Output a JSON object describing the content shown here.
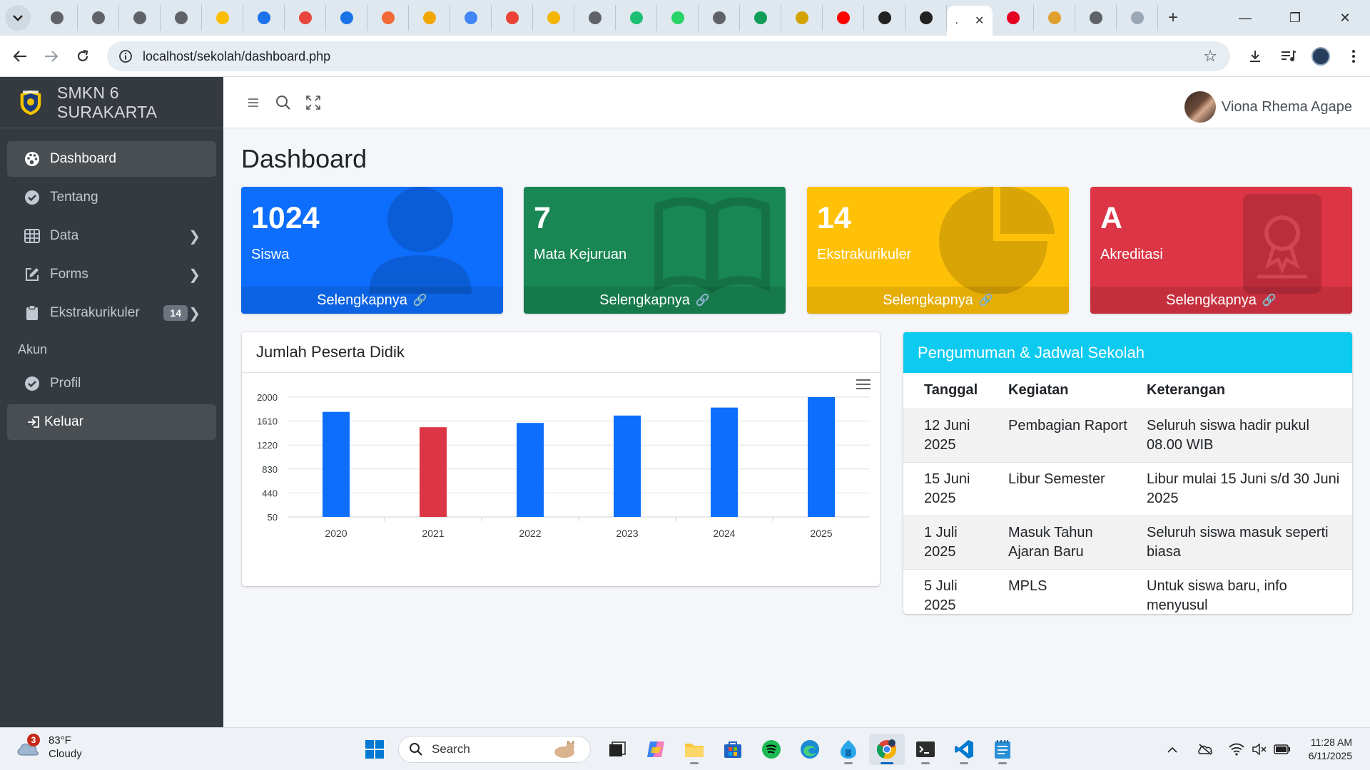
{
  "browser": {
    "url": "localhost/sekolah/dashboard.php",
    "tab_favicon_colors": [
      "#5f6368",
      "#5f6368",
      "#5f6368",
      "#5f6368",
      "#fbbc04",
      "#1a73e8",
      "#e8453c",
      "#1a73e8",
      "#f06a35",
      "#f2a600",
      "#4285f4",
      "#ea4335",
      "#f4b400",
      "#5f6368",
      "#1dbf73",
      "#25d366",
      "#5f6368",
      "#0f9d58",
      "#d4a200",
      "#ff0000",
      "#222222",
      "#222222"
    ],
    "active_tab_title": ".",
    "after_tabs_colors": [
      "#e60023",
      "#e0a030",
      "#5f6368",
      "#9aa7b5"
    ]
  },
  "sidebar": {
    "brand": "SMKN 6 SURAKARTA",
    "items": [
      {
        "label": "Dashboard",
        "icon": "palette-icon",
        "active": true
      },
      {
        "label": "Tentang",
        "icon": "circle-check-icon"
      },
      {
        "label": "Data",
        "icon": "table-icon",
        "chevron": true
      },
      {
        "label": "Forms",
        "icon": "edit-icon",
        "chevron": true
      },
      {
        "label": "Ekstrakurikuler",
        "icon": "clipboard-icon",
        "badge": "14",
        "chevron": true
      }
    ],
    "header_akun": "Akun",
    "profil": "Profil",
    "logout": "Keluar"
  },
  "topnav": {
    "user_name": "Viona Rhema Agape"
  },
  "page": {
    "title": "Dashboard"
  },
  "stats": [
    {
      "number": "1024",
      "label": "Siswa",
      "link": "Selengkapnya",
      "color": "#0d6efd",
      "icon": "person-icon"
    },
    {
      "number": "7",
      "label": "Mata Kejuruan",
      "link": "Selengkapnya",
      "color": "#198754",
      "icon": "book-icon"
    },
    {
      "number": "14",
      "label": "Ekstrakurikuler",
      "link": "Selengkapnya",
      "color": "#ffc107",
      "icon": "pie-chart-icon"
    },
    {
      "number": "A",
      "label": "Akreditasi",
      "link": "Selengkapnya",
      "color": "#dc3545",
      "icon": "certificate-icon"
    }
  ],
  "chart_card": {
    "title": "Jumlah Peserta Didik"
  },
  "chart_data": {
    "type": "bar",
    "title": "",
    "xlabel": "",
    "ylabel": "",
    "categories": [
      "2020",
      "2021",
      "2022",
      "2023",
      "2024",
      "2025"
    ],
    "values": [
      1760,
      1510,
      1580,
      1700,
      1830,
      2000
    ],
    "bar_colors": [
      "#0d6efd",
      "#dc3545",
      "#0d6efd",
      "#0d6efd",
      "#0d6efd",
      "#0d6efd"
    ],
    "yticks": [
      50,
      440,
      830,
      1220,
      1610,
      2000
    ],
    "ylim": [
      50,
      2000
    ],
    "grid": true
  },
  "schedule": {
    "title": "Pengumuman & Jadwal Sekolah",
    "headers": [
      "Tanggal",
      "Kegiatan",
      "Keterangan"
    ],
    "rows": [
      [
        "12 Juni 2025",
        "Pembagian Raport",
        "Seluruh siswa hadir pukul 08.00 WIB"
      ],
      [
        "15 Juni 2025",
        "Libur Semester",
        "Libur mulai 15 Juni s/d 30 Juni 2025"
      ],
      [
        "1 Juli 2025",
        "Masuk Tahun Ajaran Baru",
        "Seluruh siswa masuk seperti biasa"
      ],
      [
        "5 Juli 2025",
        "MPLS",
        "Untuk siswa baru, info menyusul"
      ]
    ]
  },
  "taskbar": {
    "weather_temp": "83°F",
    "weather_desc": "Cloudy",
    "weather_badge": "3",
    "search_placeholder": "Search",
    "time": "11:28 AM",
    "date": "6/11/2025"
  }
}
